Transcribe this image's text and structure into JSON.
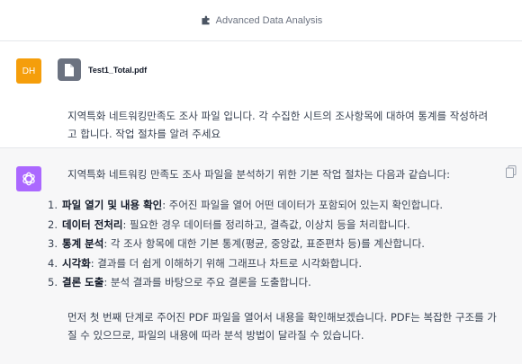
{
  "header": {
    "model_name": "Advanced Data Analysis",
    "icon": "plugin-icon"
  },
  "user": {
    "avatar_initials": "DH",
    "avatar_color": "#f59e0b",
    "attachment": {
      "file_name": "Test1_Total.pdf",
      "icon": "file-icon"
    },
    "message": "지역특화 네트워킹만족도 조사 파일 입니다. 각 수집한 시트의 조사항목에 대하여 통계를 작성하려고 합니다. 작업 절차를 알려 주세요"
  },
  "assistant": {
    "avatar_color": "#ab68ff",
    "intro": "지역특화 네트워킹 만족도 조사 파일을 분석하기 위한 기본 작업 절차는 다음과 같습니다:",
    "steps": [
      {
        "num": "1.",
        "title": "파일 열기 및 내용 확인",
        "text": ": 주어진 파일을 열어 어떤 데이터가 포함되어 있는지 확인합니다."
      },
      {
        "num": "2.",
        "title": "데이터 전처리",
        "text": ": 필요한 경우 데이터를 정리하고, 결측값, 이상치 등을 처리합니다."
      },
      {
        "num": "3.",
        "title": "통계 분석",
        "text": ": 각 조사 항목에 대한 기본 통계(평균, 중앙값, 표준편차 등)를 계산합니다."
      },
      {
        "num": "4.",
        "title": "시각화",
        "text": ": 결과를 더 쉽게 이해하기 위해 그래프나 차트로 시각화합니다."
      },
      {
        "num": "5.",
        "title": "결론 도출",
        "text": ": 분석 결과를 바탕으로 주요 결론을 도출합니다."
      }
    ],
    "outro": "먼저 첫 번째 단계로 주어진 PDF 파일을 열어서 내용을 확인해보겠습니다. PDF는 복잡한 구조를 가질 수 있으므로, 파일의 내용에 따라 분석 방법이 달라질 수 있습니다."
  }
}
